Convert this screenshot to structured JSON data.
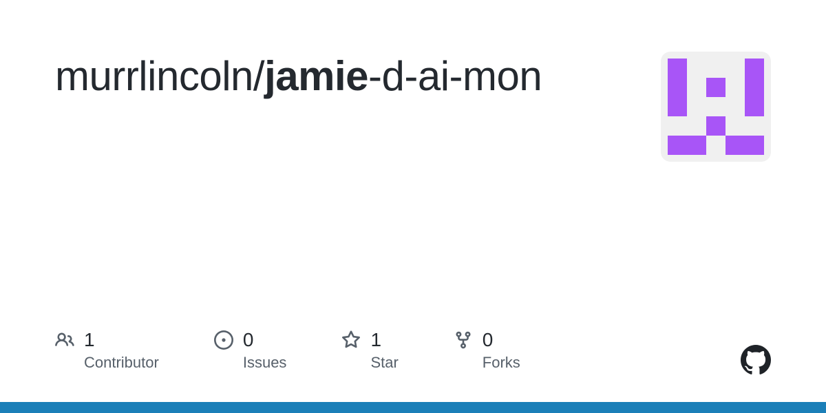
{
  "repo": {
    "owner": "murrlincoln",
    "name_bold": "jamie",
    "name_rest": "-d-ai-mon"
  },
  "stats": {
    "contributors": {
      "value": "1",
      "label": "Contributor"
    },
    "issues": {
      "value": "0",
      "label": "Issues"
    },
    "stars": {
      "value": "1",
      "label": "Star"
    },
    "forks": {
      "value": "0",
      "label": "Forks"
    }
  },
  "colors": {
    "accent": "#a855f7",
    "bottom_bar": "#1b7fb8"
  }
}
